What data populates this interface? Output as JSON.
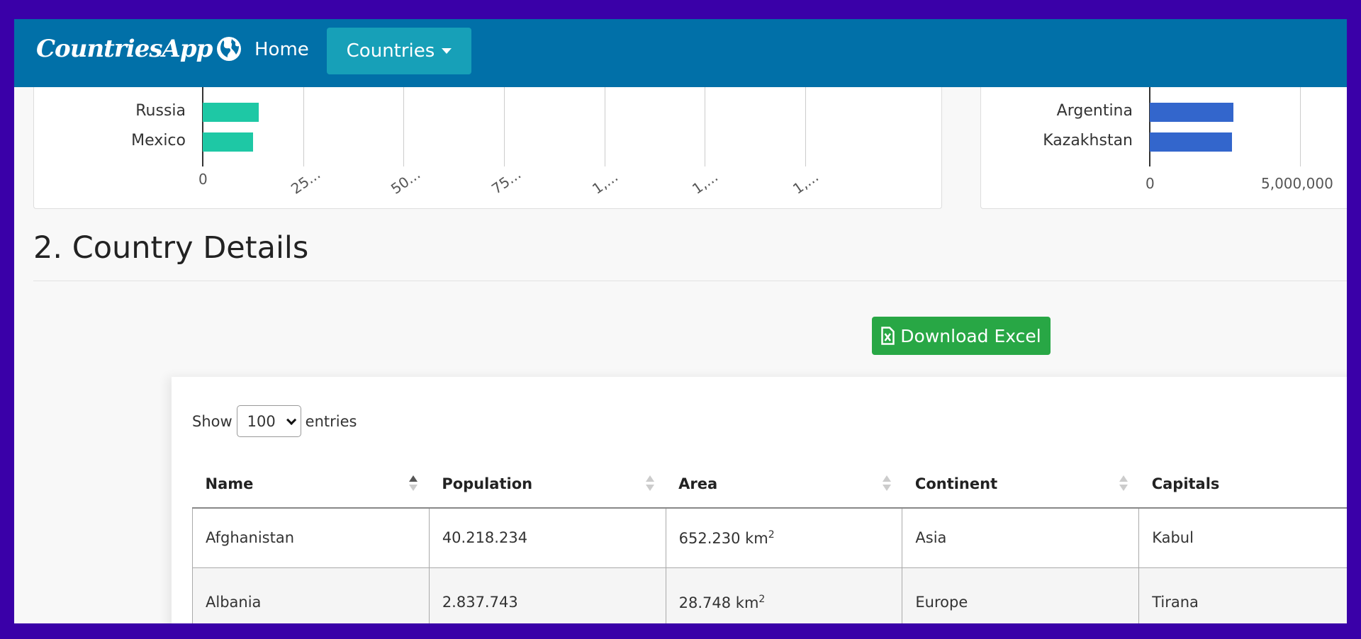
{
  "navbar": {
    "brand": "CountriesApp",
    "brand_icon": "globe-icon",
    "home_label": "Home",
    "countries_label": "Countries",
    "bg_color": "#0170a8",
    "active_color": "#17a0b8"
  },
  "chart_data": [
    {
      "type": "bar",
      "orientation": "horizontal",
      "categories": [
        "Russia",
        "Mexico"
      ],
      "series": [
        {
          "values": [
            14,
            12.5
          ],
          "color": "#1ec8a5"
        }
      ],
      "ticks": [
        "0",
        "25...",
        "50...",
        "75...",
        "1,...",
        "1,...",
        "1,..."
      ],
      "xlim": [
        0,
        150
      ],
      "grid": true
    },
    {
      "type": "bar",
      "orientation": "horizontal",
      "categories": [
        "Argentina",
        "Kazakhstan"
      ],
      "series": [
        {
          "values": [
            2780400,
            2724900
          ],
          "color": "#3366cc"
        }
      ],
      "ticks": [
        "0",
        "5,000,000"
      ],
      "xlim": [
        0,
        5000000
      ],
      "grid": true
    }
  ],
  "section": {
    "title": "2. Country Details"
  },
  "download": {
    "label": "Download Excel",
    "icon": "file-excel-icon",
    "color": "#28a745"
  },
  "table_controls": {
    "show_label": "Show",
    "entries_value": "100",
    "entries_label": "entries"
  },
  "table": {
    "columns": [
      "Name",
      "Population",
      "Area",
      "Continent",
      "Capitals"
    ],
    "rows": [
      {
        "name": "Afghanistan",
        "population": "40.218.234",
        "area": "652.230 km",
        "area_unit_sup": "2",
        "continent": "Asia",
        "capital": "Kabul"
      },
      {
        "name": "Albania",
        "population": "2.837.743",
        "area": "28.748 km",
        "area_unit_sup": "2",
        "continent": "Europe",
        "capital": "Tirana"
      }
    ]
  }
}
